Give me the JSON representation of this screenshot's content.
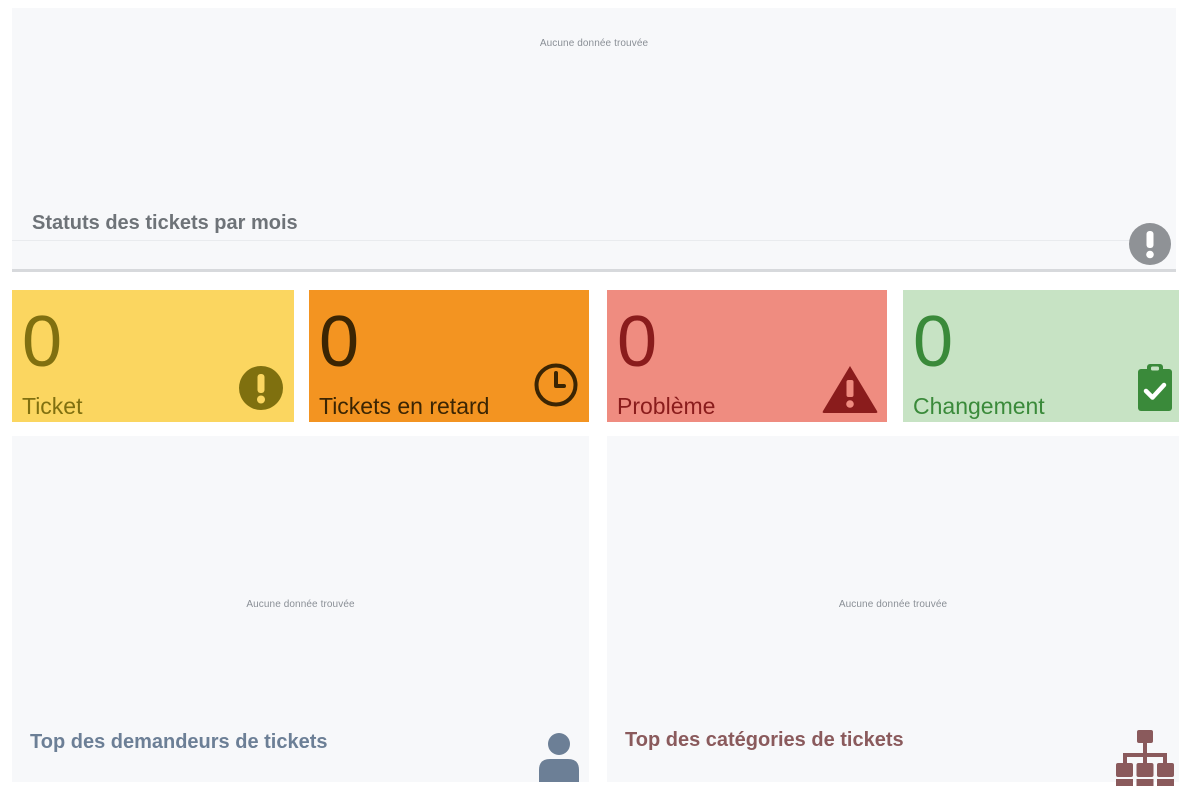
{
  "ticket_status_widget": {
    "empty_message": "Aucune donnée trouvée",
    "title": "Statuts des tickets par mois",
    "icon": "exclamation-circle-icon"
  },
  "counters": [
    {
      "value": "0",
      "label": "Ticket",
      "icon": "exclamation-circle-icon",
      "color": "#fbd660"
    },
    {
      "value": "0",
      "label": "Tickets en retard",
      "icon": "clock-icon",
      "color": "#f39421"
    },
    {
      "value": "0",
      "label": "Problème",
      "icon": "warning-triangle-icon",
      "color": "#ef8c80"
    },
    {
      "value": "0",
      "label": "Changement",
      "icon": "clipboard-check-icon",
      "color": "#c7e3c4"
    }
  ],
  "top_requesters_widget": {
    "empty_message": "Aucune donnée trouvée",
    "title": "Top des demandeurs de tickets",
    "icon": "user-icon"
  },
  "top_categories_widget": {
    "empty_message": "Aucune donnée trouvée",
    "title": "Top des catégories de tickets",
    "icon": "sitemap-icon"
  }
}
